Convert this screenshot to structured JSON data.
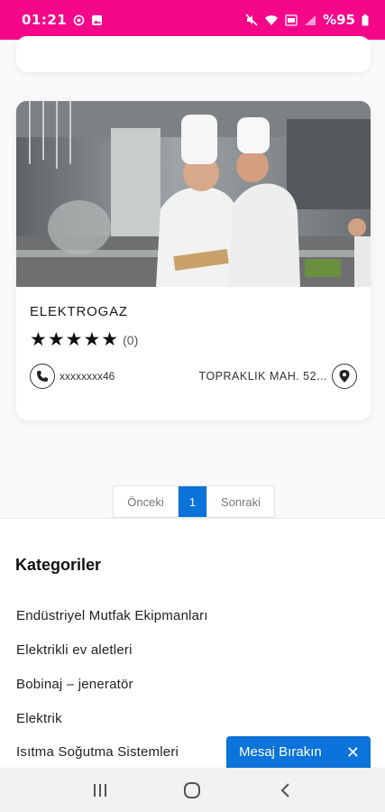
{
  "status_bar": {
    "time": "01:21",
    "battery": "%95",
    "icons": [
      "whatsapp-icon",
      "gallery-icon",
      "mute-icon",
      "wifi-icon",
      "volte-icon",
      "signal-icon",
      "battery-icon"
    ]
  },
  "listing": {
    "title": "ELEKTROGAZ",
    "stars": "★★★★★",
    "rating_count": "(0)",
    "phone": "xxxxxxxx46",
    "address": "TOPRAKLIK MAH. 52..."
  },
  "pagination": {
    "prev_label": "Önceki",
    "current_page": "1",
    "next_label": "Sonraki"
  },
  "categories": {
    "title": "Kategoriler",
    "items": [
      "Endüstriyel Mutfak Ekipmanları",
      "Elektrikli ev aletleri",
      "Bobinaj – jeneratör",
      "Elektrik",
      "Isıtma Soğutma Sistemleri"
    ]
  },
  "message_widget": {
    "label": "Mesaj Bırakın",
    "close": "✕"
  },
  "colors": {
    "status_bar": "#f5078a",
    "accent": "#0b73d9"
  }
}
